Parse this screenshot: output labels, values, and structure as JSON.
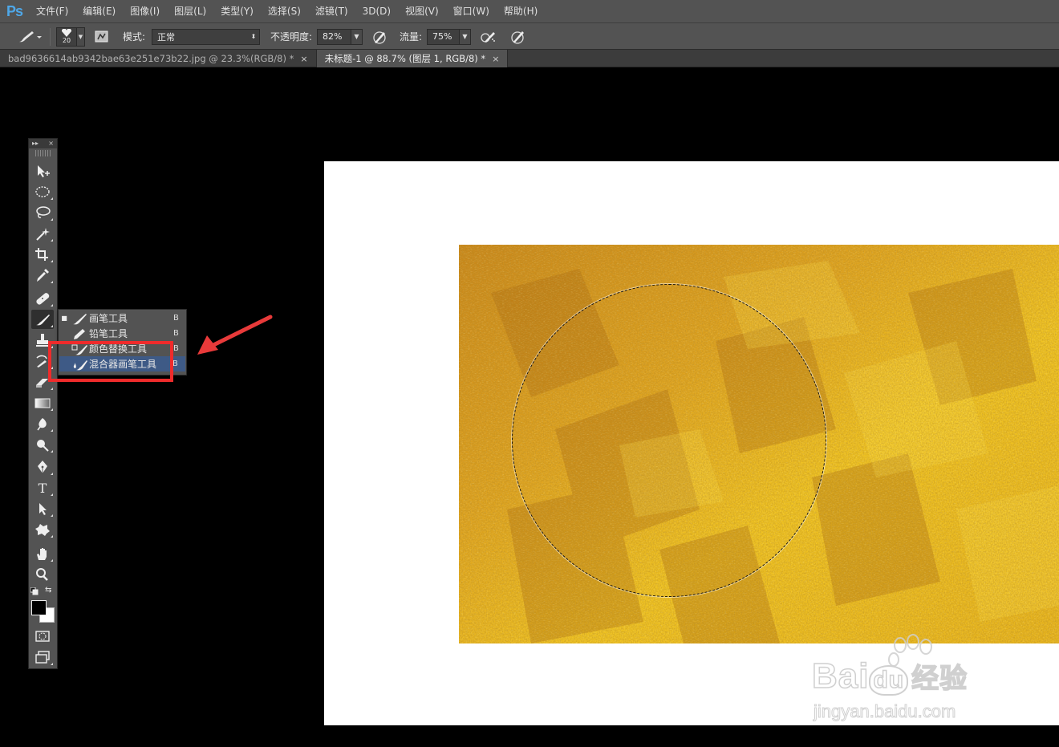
{
  "app": {
    "logo": "Ps"
  },
  "menu": [
    "文件(F)",
    "编辑(E)",
    "图像(I)",
    "图层(L)",
    "类型(Y)",
    "选择(S)",
    "滤镜(T)",
    "3D(D)",
    "视图(V)",
    "窗口(W)",
    "帮助(H)"
  ],
  "options": {
    "brush_size": "20",
    "mode_label": "模式:",
    "mode_value": "正常",
    "opacity_label": "不透明度:",
    "opacity_value": "82%",
    "flow_label": "流量:",
    "flow_value": "75%"
  },
  "tabs": [
    {
      "label": "bad9636614ab9342bae63e251e73b22.jpg @ 23.3%(RGB/8) *",
      "close": "×",
      "active": false
    },
    {
      "label": "未标题-1 @ 88.7% (图层 1, RGB/8) *",
      "close": "×",
      "active": true
    }
  ],
  "toolbox": {
    "header_collapse": "▸▸",
    "header_close": "×",
    "tools": [
      "move-tool",
      "elliptical-marquee-tool",
      "lasso-tool",
      "magic-wand-tool",
      "crop-tool",
      "eyedropper-tool",
      "spot-healing-tool",
      "brush-tool",
      "clone-stamp-tool",
      "history-brush-tool",
      "eraser-tool",
      "gradient-tool",
      "blur-tool",
      "dodge-tool",
      "pen-tool",
      "type-tool",
      "path-selection-tool",
      "custom-shape-tool",
      "hand-tool",
      "zoom-tool"
    ],
    "type_glyph": "T",
    "foreground_color": "#000000",
    "background_color": "#ffffff"
  },
  "flyout": {
    "items": [
      {
        "label": "画笔工具",
        "key": "B",
        "current": true,
        "highlighted": false
      },
      {
        "label": "铅笔工具",
        "key": "B",
        "current": false,
        "highlighted": false
      },
      {
        "label": "颜色替换工具",
        "key": "B",
        "current": false,
        "highlighted": false
      },
      {
        "label": "混合器画笔工具",
        "key": "B",
        "current": false,
        "highlighted": true
      }
    ]
  },
  "annotation": {
    "box_color": "#ef2b2b",
    "arrow_color": "#e83a3a"
  },
  "watermark": {
    "brand": "Bai",
    "brand2": "du",
    "cn": "经验",
    "url": "jingyan.baidu.com"
  },
  "colors": {
    "chrome": "#535353",
    "tab_bar": "#3c3c3c",
    "highlight": "#3e5a86",
    "ps_blue": "#4ea7e8"
  }
}
